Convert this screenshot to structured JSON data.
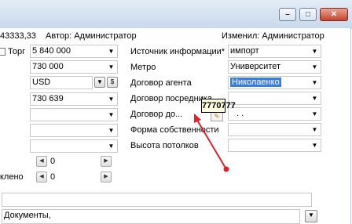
{
  "header": {
    "amount_fragment": "43333,33",
    "author": "Автор: Администратор",
    "modified": "Изменил: Администратор"
  },
  "left": {
    "torg_label": "Торг",
    "price": "5 840 000",
    "price2": "730 000",
    "currency": "USD",
    "value": "730 639",
    "spin1_value": "0",
    "spin2_value": "0",
    "cut_label": "клено"
  },
  "right": {
    "rows": [
      {
        "label": "Источник информации*",
        "value": "импорт"
      },
      {
        "label": "Метро",
        "value": "Университет"
      },
      {
        "label": "Договор агента",
        "value": "Николаенко"
      },
      {
        "label": "Договор посредника",
        "value": ""
      },
      {
        "label": "Договор до...",
        "value": ". ."
      },
      {
        "label": "Форма собственности",
        "value": ""
      },
      {
        "label": "Высота потолков",
        "value": ""
      }
    ]
  },
  "tooltip": {
    "text": "7770777"
  },
  "bottom": {
    "documents_label": "Документы,"
  },
  "colors": {
    "annotation_arrow": "#e0202a",
    "selection": "#3b7de0"
  }
}
